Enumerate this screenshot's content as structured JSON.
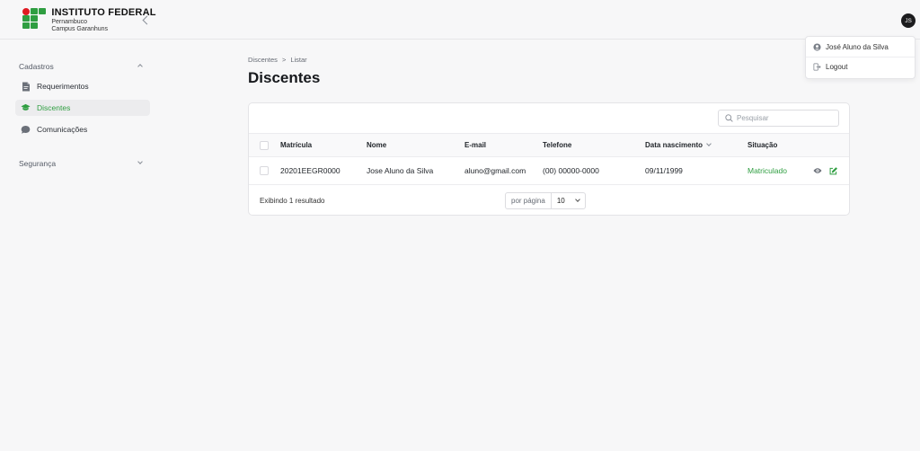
{
  "header": {
    "logo_title": "INSTITUTO FEDERAL",
    "logo_line1": "Pernambuco",
    "logo_line2": "Campus Garanhuns",
    "avatar_initials": "JS"
  },
  "user_menu": {
    "user_name": "José Aluno da Silva",
    "logout_label": "Logout"
  },
  "sidebar": {
    "section_cadastros": "Cadastros",
    "items": [
      {
        "label": "Requerimentos",
        "icon": "document-icon"
      },
      {
        "label": "Discentes",
        "icon": "graduation-cap-icon"
      },
      {
        "label": "Comunicações",
        "icon": "chat-bubble-icon"
      }
    ],
    "section_seguranca": "Segurança"
  },
  "breadcrumb": {
    "parent": "Discentes",
    "separator": ">",
    "current": "Listar"
  },
  "page_title": "Discentes",
  "search": {
    "placeholder": "Pesquisar"
  },
  "table": {
    "columns": [
      "Matrícula",
      "Nome",
      "E-mail",
      "Telefone",
      "Data nascimento",
      "Situação"
    ],
    "rows": [
      {
        "matricula": "20201EEGR0000",
        "nome": "Jose Aluno da Silva",
        "email": "aluno@gmail.com",
        "telefone": "(00) 00000-0000",
        "nascimento": "09/11/1999",
        "situacao": "Matriculado"
      }
    ]
  },
  "footer": {
    "result_count": "Exibindo 1 resultado",
    "per_page_label": "por página",
    "per_page_value": "10"
  },
  "colors": {
    "accent_green": "#2f9e41",
    "logo_red": "#e01a22"
  }
}
